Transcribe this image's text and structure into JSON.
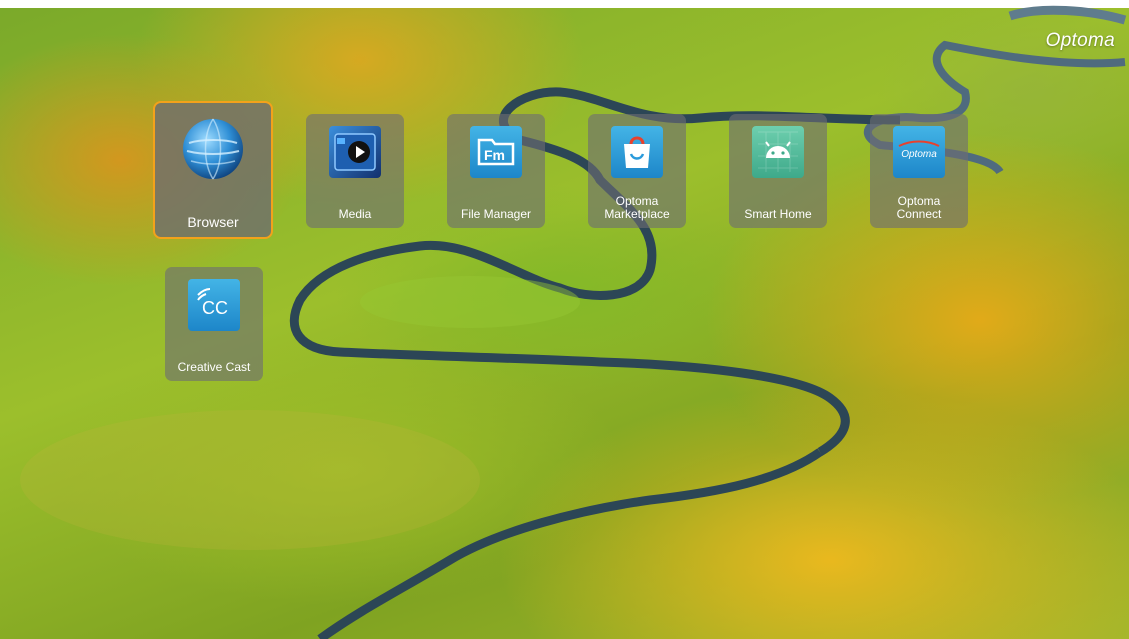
{
  "brand": {
    "logo_text": "Optoma",
    "focus_color": "#f3a21b"
  },
  "apps": [
    {
      "label": "Browser",
      "icon": "globe-icon",
      "focused": true
    },
    {
      "label": "Media",
      "icon": "media-play-icon"
    },
    {
      "label": "File Manager",
      "icon": "file-manager-icon"
    },
    {
      "label": "Optoma\nMarketplace",
      "icon": "shopping-bag-icon"
    },
    {
      "label": "Smart Home",
      "icon": "android-icon"
    },
    {
      "label": "Optoma\nConnect",
      "icon": "optoma-logo-icon",
      "icon_text": "Optoma"
    },
    {
      "label": "Creative Cast",
      "icon": "creative-cast-icon",
      "icon_text": "CC"
    }
  ]
}
